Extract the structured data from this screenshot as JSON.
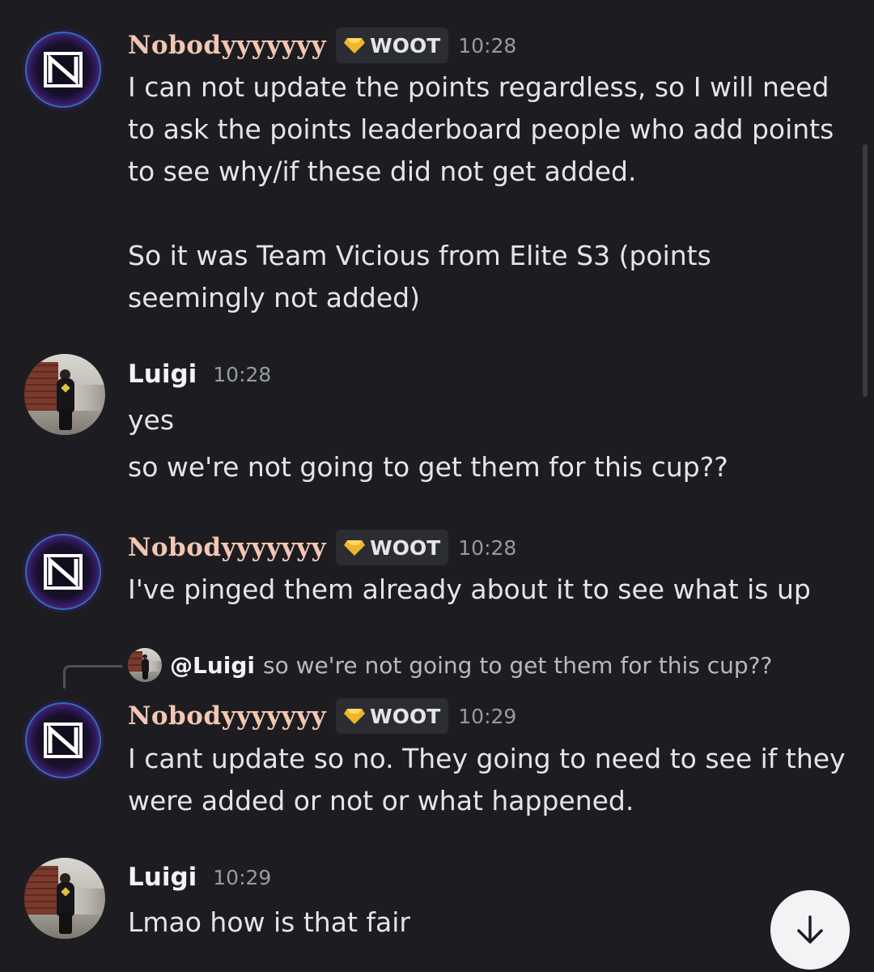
{
  "messages": [
    {
      "author": "Nobodyyyyyyy",
      "tag": "WOOT",
      "time": "10:28",
      "lines": [
        "I can not update the points regardless, so I will need",
        "to ask the points leaderboard people who add points",
        "to see why/if these did not get added.",
        "",
        "So it was Team Vicious from Elite S3 (points",
        "seemingly not added)"
      ]
    },
    {
      "author": "Luigi",
      "time": "10:28",
      "lines": [
        "yes"
      ],
      "followup": "so we're not going to get them for this cup??"
    },
    {
      "author": "Nobodyyyyyyy",
      "tag": "WOOT",
      "time": "10:28",
      "lines": [
        "I've pinged them already about it to see what is up"
      ]
    },
    {
      "reply_to": {
        "mention": "@Luigi",
        "snippet": "so we're not going to get them for this cup??"
      },
      "author": "Nobodyyyyyyy",
      "tag": "WOOT",
      "time": "10:29",
      "lines": [
        "I cant update so no. They going to need to see if they",
        "were added or not or what happened."
      ]
    },
    {
      "author": "Luigi",
      "time": "10:29",
      "lines": [
        "Lmao how is that fair"
      ]
    }
  ],
  "icons": {
    "tag_icon": "diamond-gem-icon",
    "jump_button": "arrow-down-icon"
  },
  "colors": {
    "background": "#1d1d21",
    "fancy_name": "#f3c6b3",
    "tag_bg": "#2b2d33",
    "timestamp": "#949ba4"
  }
}
